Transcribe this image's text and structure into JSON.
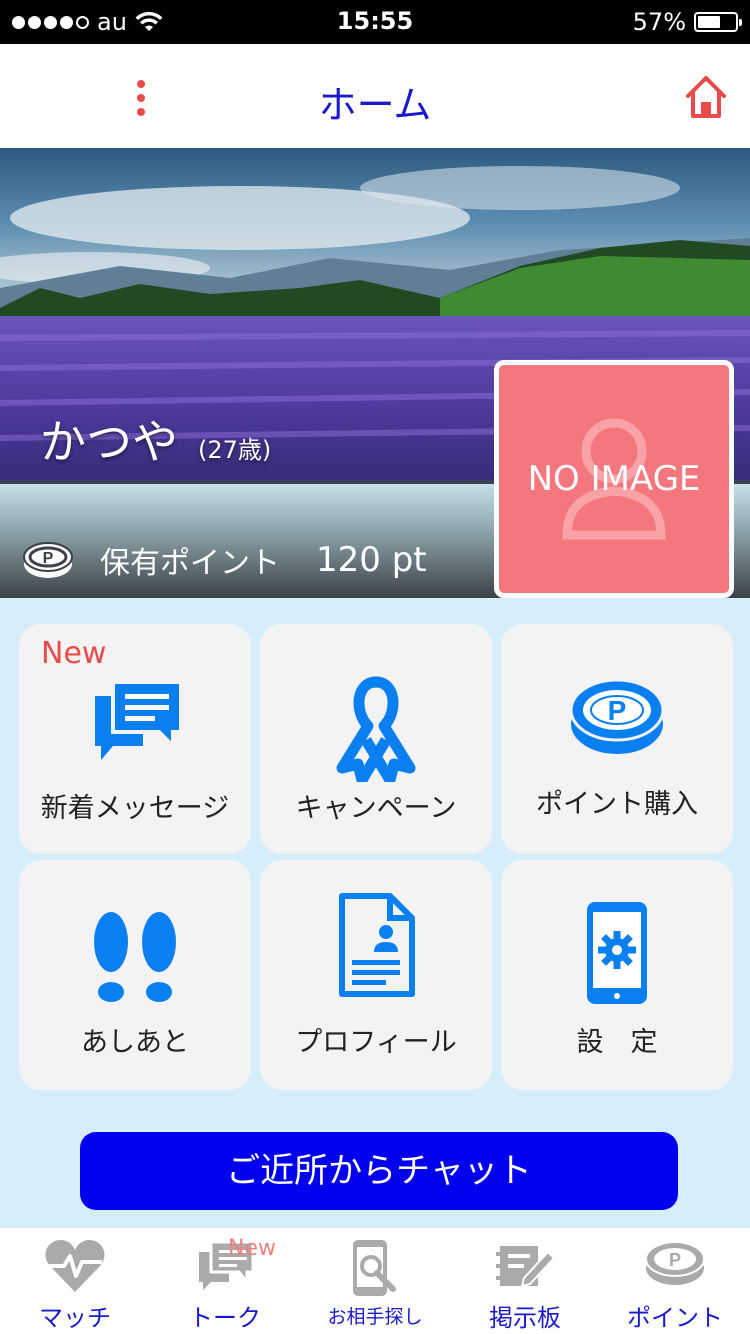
{
  "status_bar": {
    "carrier": "au",
    "time": "15:55",
    "battery": "57%",
    "battery_level": 0.57
  },
  "header": {
    "title": "ホーム"
  },
  "profile": {
    "name": "かつや",
    "age": "(27歳)",
    "points_label": "保有ポイント",
    "points_value": "120 pt",
    "avatar_text": "NO IMAGE"
  },
  "menu": {
    "new_badge": "New",
    "messages": "新着メッセージ",
    "campaign": "キャンペーン",
    "buy_points": "ポイント購入",
    "footprints": "あしあと",
    "profile": "プロフィール",
    "settings": "設　定"
  },
  "chat_button": "ご近所からチャット",
  "tabs": {
    "match": "マッチ",
    "talk": "トーク",
    "talk_badge": "New",
    "search": "お相手探し",
    "board": "掲示板",
    "points": "ポイント"
  },
  "colors": {
    "accent_blue": "#1a1acc",
    "icon_blue": "#0a7ff0",
    "badge_red": "#e94b4b",
    "chat_button": "#0000ee",
    "avatar_bg": "#f4777e"
  }
}
